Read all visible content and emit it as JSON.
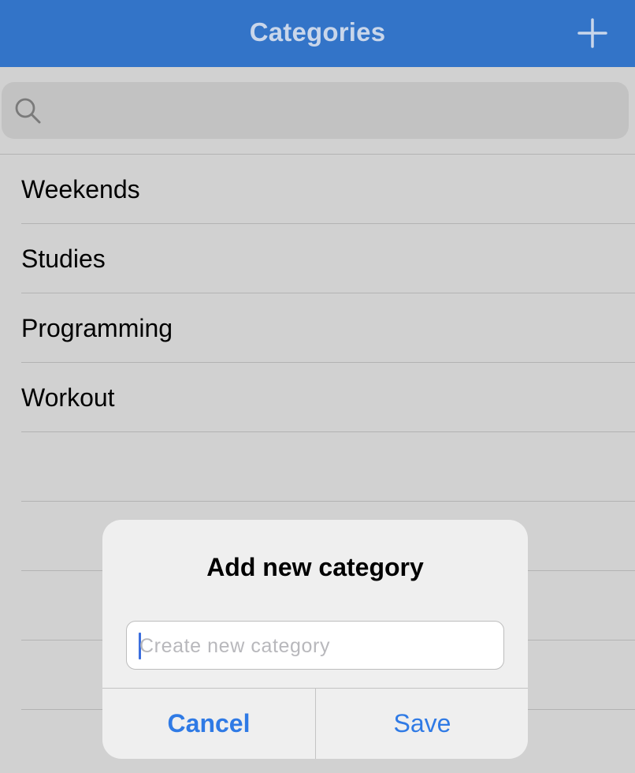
{
  "navbar": {
    "title": "Categories",
    "add_icon": "plus-icon",
    "background": "#3374c8"
  },
  "search": {
    "icon": "magnifier-icon",
    "placeholder": "",
    "value": ""
  },
  "categories": [
    {
      "label": "Weekends"
    },
    {
      "label": "Studies"
    },
    {
      "label": "Programming"
    },
    {
      "label": "Workout"
    }
  ],
  "dialog": {
    "title": "Add new category",
    "input_placeholder": "Create new category",
    "input_value": "",
    "cancel_label": "Cancel",
    "save_label": "Save",
    "accent": "#2f7ae5"
  }
}
